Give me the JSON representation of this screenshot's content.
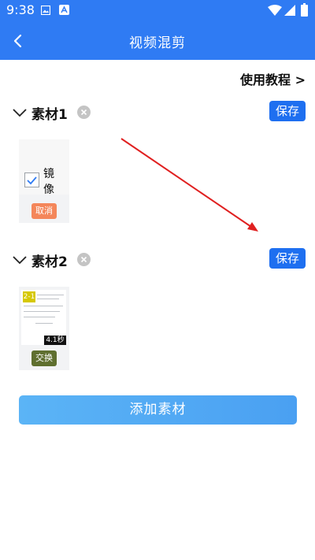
{
  "status_bar": {
    "time": "9:38"
  },
  "app_bar": {
    "title": "视频混剪"
  },
  "tutorial_link": "使用教程 >",
  "materials": [
    {
      "title": "素材1",
      "save_label": "保存",
      "mirror_label": "镜像",
      "mirror_checked": true,
      "action_label": "取消"
    },
    {
      "title": "素材2",
      "save_label": "保存",
      "preview_tag": "2-1",
      "preview_time": "4.1秒",
      "action_label": "交换"
    }
  ],
  "add_button": "添加素材",
  "colors": {
    "primary": "#2f7bf3",
    "save_button": "#1e6ff0",
    "cancel_button": "#f4865a",
    "swap_button": "#5f6f2f",
    "annotation_arrow": "#e02020"
  },
  "icons": {
    "back": "back-arrow-icon",
    "collapse": "chevron-down-icon",
    "remove": "close-circle-icon",
    "checkbox": "checkmark-icon"
  }
}
